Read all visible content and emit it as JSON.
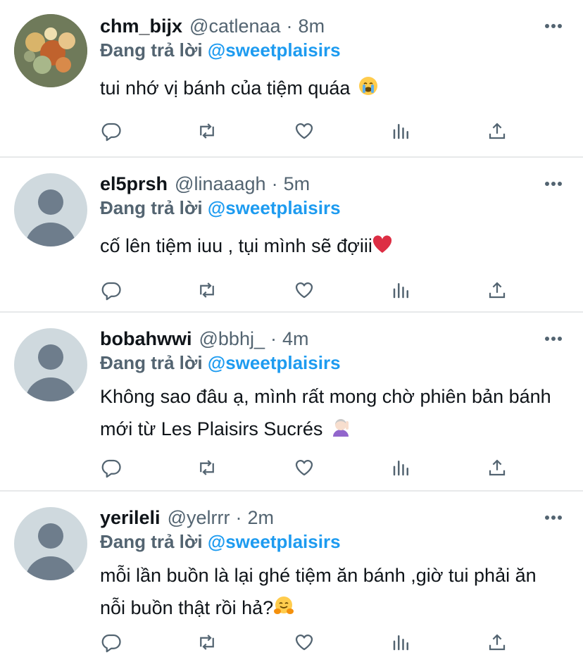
{
  "reply_prefix": "Đang trả lời",
  "tweets": [
    {
      "name": "chm_bijx",
      "handle": "@catlenaa",
      "separator": "·",
      "time": "8m",
      "reply_to": "@sweetplaisirs",
      "text": "tui nhớ vị bánh của tiệm quáa",
      "emoji": "loudly-crying-face",
      "avatar": "photo"
    },
    {
      "name": "el5prsh",
      "handle": "@linaaagh",
      "separator": "·",
      "time": "5m",
      "reply_to": "@sweetplaisirs",
      "text": "cố lên tiệm iuu , tụi mình sẽ đợiii",
      "emoji": "red-heart",
      "avatar": "default"
    },
    {
      "name": "bobahwwi",
      "handle": "@bbhj_",
      "separator": "·",
      "time": "4m",
      "reply_to": "@sweetplaisirs",
      "text": "Không sao đâu ạ, mình rất mong chờ phiên bản bánh mới từ Les Plaisirs Sucrés",
      "emoji": "person-tipping-hand",
      "avatar": "default"
    },
    {
      "name": "yerileli",
      "handle": "@yelrrr",
      "separator": "·",
      "time": "2m",
      "reply_to": "@sweetplaisirs",
      "text": "mỗi lần buồn là lại ghé tiệm ăn bánh ,giờ tui phải ăn nỗi buồn thật rồi hả?",
      "emoji": "hugging-face",
      "avatar": "default"
    }
  ],
  "actions": [
    "reply-icon",
    "retweet-icon",
    "like-icon",
    "analytics-icon",
    "share-icon"
  ],
  "colors": {
    "text": "#0f1419",
    "secondary": "#536471",
    "accent": "#1d9bf0",
    "divider": "#e7e9ea",
    "avatar_default": "#cfd9de",
    "avatar_silhouette": "#6e7d8c"
  }
}
